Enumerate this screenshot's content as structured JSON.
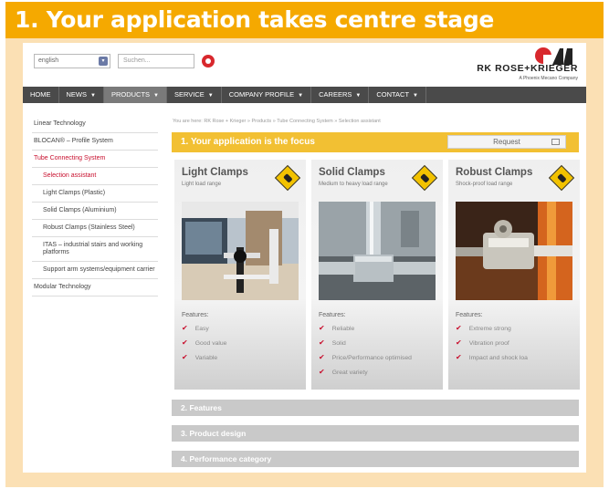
{
  "slide_title": "1. Your application takes centre stage",
  "header": {
    "language": "english",
    "search_placeholder": "Suchen...",
    "brand": "RK ROSE+KRIEGER",
    "brand_sub": "A Phoenix Mecano Company"
  },
  "nav": [
    "HOME",
    "NEWS",
    "PRODUCTS",
    "SERVICE",
    "COMPANY PROFILE",
    "CAREERS",
    "CONTACT"
  ],
  "sidebar": [
    {
      "label": "Linear Technology"
    },
    {
      "label": "BLOCAN® – Profile System"
    },
    {
      "label": "Tube Connecting System"
    },
    {
      "label": "Selection assistant"
    },
    {
      "label": "Light Clamps (Plastic)"
    },
    {
      "label": "Solid Clamps (Aluminium)"
    },
    {
      "label": "Robust Clamps (Stainless Steel)"
    },
    {
      "label": "ITAS – industrial stairs and working platforms"
    },
    {
      "label": "Support arm systems/equipment carrier"
    },
    {
      "label": "Modular Technology"
    }
  ],
  "breadcrumb": "You are here: RK Rose + Krieger » Products » Tube Connecting System » Selection assistant",
  "focus": {
    "title": "1. Your application is the focus",
    "request": "Request"
  },
  "cards": [
    {
      "title": "Light Clamps",
      "subtitle": "Light load range",
      "features_label": "Features:",
      "features": [
        "Easy",
        "Good value",
        "Variable"
      ]
    },
    {
      "title": "Solid Clamps",
      "subtitle": "Medium to heavy load range",
      "features_label": "Features:",
      "features": [
        "Reliable",
        "Solid",
        "Price/Performance optimised",
        "Great variety"
      ]
    },
    {
      "title": "Robust Clamps",
      "subtitle": "Shock-proof load range",
      "features_label": "Features:",
      "features": [
        "Extreme strong",
        "Vibration proof",
        "Impact and shock loa"
      ]
    }
  ],
  "accordion": [
    "2. Features",
    "3. Product design",
    "4. Performance category"
  ],
  "colors": {
    "accent": "#f5a900",
    "focus_bar": "#f2c033",
    "nav_bg": "#4a4a4a",
    "link_red": "#c8102e"
  }
}
